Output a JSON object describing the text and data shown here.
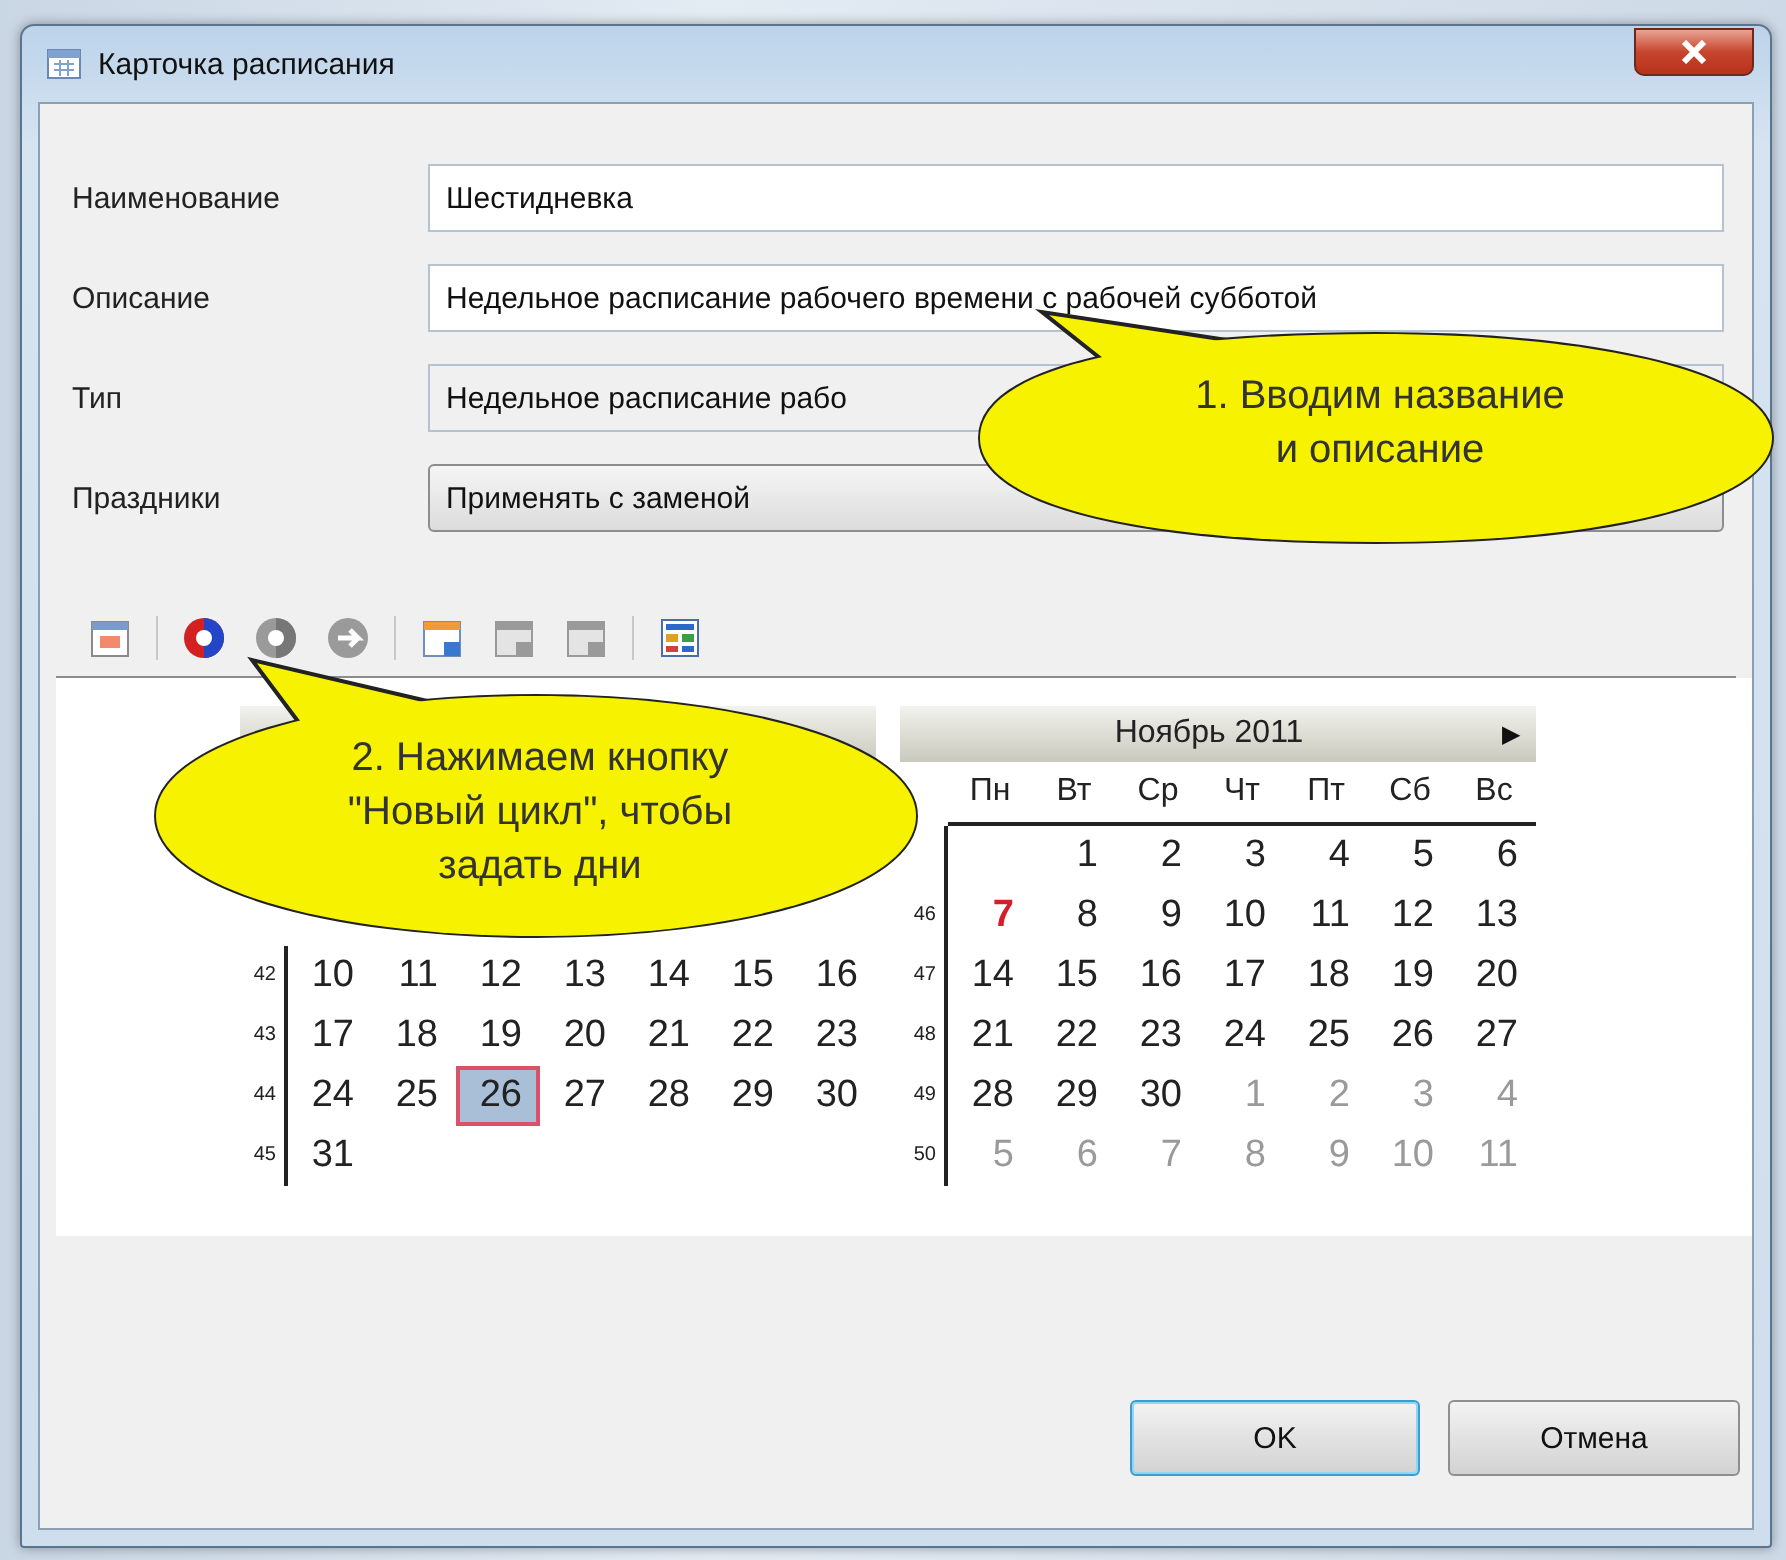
{
  "window": {
    "title": "Карточка расписания"
  },
  "form": [
    {
      "label": "Наименование",
      "value": "Шестидневка",
      "kind": "text",
      "disabled": false
    },
    {
      "label": "Описание",
      "value": "Недельное расписание рабочего времени с рабочей субботой",
      "kind": "text",
      "disabled": false
    },
    {
      "label": "Тип",
      "value": "Недельное расписание рабо",
      "kind": "text",
      "disabled": true
    },
    {
      "label": "Праздники",
      "value": "Применять с заменой",
      "kind": "combo",
      "disabled": false
    }
  ],
  "toolbar": [
    {
      "kind": "calendar",
      "disabled": false
    },
    {
      "kind": "separator"
    },
    {
      "kind": "cycle",
      "disabled": false
    },
    {
      "kind": "cycle",
      "disabled": true
    },
    {
      "kind": "cycle-back",
      "disabled": true
    },
    {
      "kind": "separator"
    },
    {
      "kind": "calendar-edit",
      "disabled": false
    },
    {
      "kind": "calendar-edit",
      "disabled": true
    },
    {
      "kind": "calendar-edit",
      "disabled": true
    },
    {
      "kind": "separator"
    },
    {
      "kind": "grid",
      "disabled": false
    }
  ],
  "calendars": [
    {
      "weeks": [
        {
          "number": "42",
          "days": [
            {
              "day": "10",
              "kind": "current",
              "selected": false
            },
            {
              "day": "11",
              "kind": "current",
              "selected": false
            },
            {
              "day": "12",
              "kind": "current",
              "selected": false
            },
            {
              "day": "13",
              "kind": "current",
              "selected": false
            },
            {
              "day": "14",
              "kind": "current",
              "selected": false
            },
            {
              "day": "15",
              "kind": "current",
              "selected": false
            },
            {
              "day": "16",
              "kind": "current",
              "selected": false
            }
          ]
        },
        {
          "number": "43",
          "days": [
            {
              "day": "17",
              "kind": "current",
              "selected": false
            },
            {
              "day": "18",
              "kind": "current",
              "selected": false
            },
            {
              "day": "19",
              "kind": "current",
              "selected": false
            },
            {
              "day": "20",
              "kind": "current",
              "selected": false
            },
            {
              "day": "21",
              "kind": "current",
              "selected": false
            },
            {
              "day": "22",
              "kind": "current",
              "selected": false
            },
            {
              "day": "23",
              "kind": "current",
              "selected": false
            }
          ]
        },
        {
          "number": "44",
          "days": [
            {
              "day": "24",
              "kind": "current",
              "selected": false
            },
            {
              "day": "25",
              "kind": "current",
              "selected": false
            },
            {
              "day": "26",
              "kind": "current",
              "selected": true
            },
            {
              "day": "27",
              "kind": "current",
              "selected": false
            },
            {
              "day": "28",
              "kind": "current",
              "selected": false
            },
            {
              "day": "29",
              "kind": "current",
              "selected": false
            },
            {
              "day": "30",
              "kind": "current",
              "selected": false
            }
          ]
        },
        {
          "number": "45",
          "days": [
            {
              "day": "31",
              "kind": "current",
              "selected": false
            }
          ]
        }
      ]
    },
    {
      "title": "Ноябрь 2011",
      "next": "▶",
      "weekdays": [
        "Пн",
        "Вт",
        "Ср",
        "Чт",
        "Пт",
        "Сб",
        "Вс"
      ],
      "weeks": [
        {
          "days": [
            {
              "day": "1",
              "kind": "current",
              "selected": false
            },
            {
              "day": "2",
              "kind": "current",
              "selected": false
            },
            {
              "day": "3",
              "kind": "current",
              "selected": false
            },
            {
              "day": "4",
              "kind": "current",
              "selected": false
            },
            {
              "day": "5",
              "kind": "current",
              "selected": false
            },
            {
              "day": "6",
              "kind": "current",
              "selected": false
            }
          ]
        },
        {
          "number": "46",
          "days": [
            {
              "day": "7",
              "kind": "holiday",
              "selected": false
            },
            {
              "day": "8",
              "kind": "current",
              "selected": false
            },
            {
              "day": "9",
              "kind": "current",
              "selected": false
            },
            {
              "day": "10",
              "kind": "current",
              "selected": false
            },
            {
              "day": "11",
              "kind": "current",
              "selected": false
            },
            {
              "day": "12",
              "kind": "current",
              "selected": false
            },
            {
              "day": "13",
              "kind": "current",
              "selected": false
            }
          ]
        },
        {
          "number": "47",
          "days": [
            {
              "day": "14",
              "kind": "current",
              "selected": false
            },
            {
              "day": "15",
              "kind": "current",
              "selected": false
            },
            {
              "day": "16",
              "kind": "current",
              "selected": false
            },
            {
              "day": "17",
              "kind": "current",
              "selected": false
            },
            {
              "day": "18",
              "kind": "current",
              "selected": false
            },
            {
              "day": "19",
              "kind": "current",
              "selected": false
            },
            {
              "day": "20",
              "kind": "current",
              "selected": false
            }
          ]
        },
        {
          "number": "48",
          "days": [
            {
              "day": "21",
              "kind": "current",
              "selected": false
            },
            {
              "day": "22",
              "kind": "current",
              "selected": false
            },
            {
              "day": "23",
              "kind": "current",
              "selected": false
            },
            {
              "day": "24",
              "kind": "current",
              "selected": false
            },
            {
              "day": "25",
              "kind": "current",
              "selected": false
            },
            {
              "day": "26",
              "kind": "current",
              "selected": false
            },
            {
              "day": "27",
              "kind": "current",
              "selected": false
            }
          ]
        },
        {
          "number": "49",
          "days": [
            {
              "day": "28",
              "kind": "current",
              "selected": false
            },
            {
              "day": "29",
              "kind": "current",
              "selected": false
            },
            {
              "day": "30",
              "kind": "current",
              "selected": false
            },
            {
              "day": "1",
              "kind": "other",
              "selected": false
            },
            {
              "day": "2",
              "kind": "other",
              "selected": false
            },
            {
              "day": "3",
              "kind": "other",
              "selected": false
            },
            {
              "day": "4",
              "kind": "other",
              "selected": false
            }
          ]
        },
        {
          "number": "50",
          "days": [
            {
              "day": "5",
              "kind": "other",
              "selected": false
            },
            {
              "day": "6",
              "kind": "other",
              "selected": false
            },
            {
              "day": "7",
              "kind": "other",
              "selected": false
            },
            {
              "day": "8",
              "kind": "other",
              "selected": false
            },
            {
              "day": "9",
              "kind": "other",
              "selected": false
            },
            {
              "day": "10",
              "kind": "other",
              "selected": false
            },
            {
              "day": "11",
              "kind": "other",
              "selected": false
            }
          ]
        }
      ]
    }
  ],
  "callouts": [
    {
      "text": "1. Вводим название\nи описание",
      "kind": "right"
    },
    {
      "text": "2. Нажимаем кнопку\n\"Новый цикл\", чтобы\nзадать дни",
      "kind": "left"
    }
  ],
  "buttons": [
    {
      "label": "OK",
      "default": true
    },
    {
      "label": "Отмена",
      "default": false
    }
  ]
}
